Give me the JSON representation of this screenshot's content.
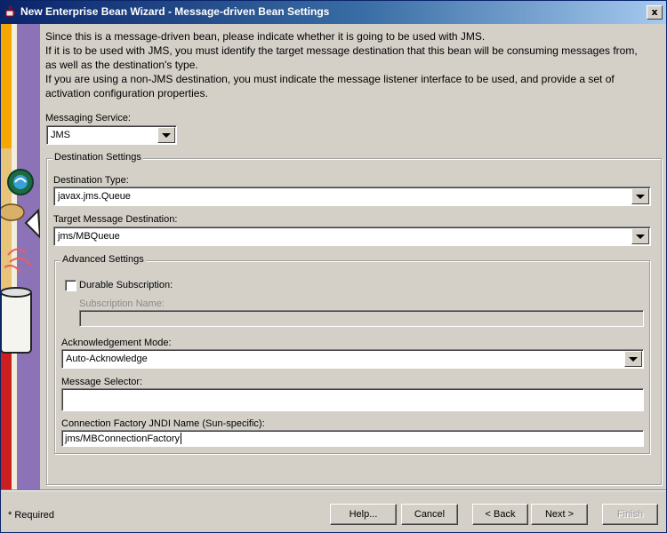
{
  "window": {
    "title": "New Enterprise Bean Wizard - Message-driven Bean Settings",
    "close_label": "x"
  },
  "intro": [
    "Since this is a message-driven bean, please indicate whether it is going to be used with JMS.",
    "If it is to be used with JMS, you must identify the target message destination that this bean will be consuming messages from,",
    "as well as the destination's type.",
    "If you are using a non-JMS destination, you must indicate the message listener interface to be used, and provide a set of",
    "activation configuration properties."
  ],
  "messaging_service": {
    "label": "Messaging Service:",
    "value": "JMS"
  },
  "destination_settings": {
    "legend": "Destination Settings",
    "destination_type": {
      "label": "Destination Type:",
      "value": "javax.jms.Queue"
    },
    "target_destination": {
      "label": "Target Message Destination:",
      "value": "jms/MBQueue"
    }
  },
  "advanced_settings": {
    "legend": "Advanced Settings",
    "durable_subscription": {
      "label": "Durable Subscription:",
      "checked": false
    },
    "subscription_name": {
      "label": "Subscription Name:",
      "value": ""
    },
    "acknowledgement_mode": {
      "label": "Acknowledgement Mode:",
      "value": "Auto-Acknowledge"
    },
    "message_selector": {
      "label": "Message Selector:",
      "value": ""
    },
    "connection_factory": {
      "label": "Connection Factory JNDI Name (Sun-specific):",
      "value": "jms/MBConnectionFactory"
    }
  },
  "footer": {
    "required_note": "* Required",
    "buttons": {
      "help": "Help...",
      "cancel": "Cancel",
      "back": "< Back",
      "next": "Next >",
      "finish": "Finish"
    }
  },
  "colors": {
    "title_start": "#0a246a",
    "title_end": "#a6caf0",
    "dialog_bg": "#d4d0c8",
    "sidebar_stripe": "#7d5fa8"
  }
}
